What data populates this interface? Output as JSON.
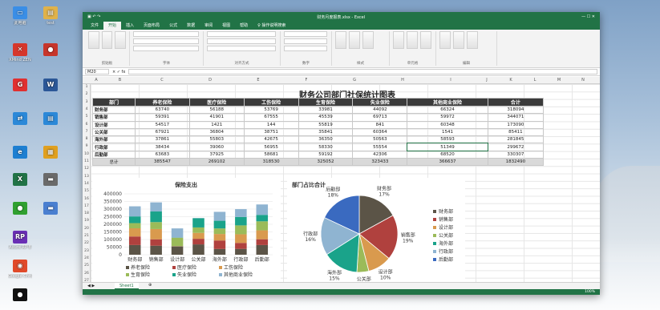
{
  "desktop": {
    "icons": [
      {
        "label": "此电脑",
        "color": "#3a8ee6",
        "glyph": "▭",
        "x": 0,
        "y": 0
      },
      {
        "label": "test",
        "color": "#e0b24a",
        "glyph": "▤",
        "x": 38,
        "y": 0
      },
      {
        "label": "XMind ZEN",
        "color": "#d6372b",
        "glyph": "✕",
        "x": 0,
        "y": 46
      },
      {
        "label": "",
        "color": "#c7352b",
        "glyph": "●",
        "x": 38,
        "y": 46
      },
      {
        "label": "",
        "color": "#e03030",
        "glyph": "G",
        "x": 0,
        "y": 90
      },
      {
        "label": "",
        "color": "#2b5797",
        "glyph": "W",
        "x": 38,
        "y": 90
      },
      {
        "label": "",
        "color": "#2b88d8",
        "glyph": "⇄",
        "x": 0,
        "y": 132
      },
      {
        "label": "",
        "color": "#2b88d8",
        "glyph": "▤",
        "x": 38,
        "y": 132
      },
      {
        "label": "",
        "color": "#1e7fd1",
        "glyph": "e",
        "x": 0,
        "y": 174
      },
      {
        "label": "",
        "color": "#e0a020",
        "glyph": "▦",
        "x": 38,
        "y": 174
      },
      {
        "label": "",
        "color": "#217346",
        "glyph": "X",
        "x": 0,
        "y": 208
      },
      {
        "label": "",
        "color": "#6a6a6a",
        "glyph": "▬",
        "x": 38,
        "y": 208
      },
      {
        "label": "",
        "color": "#30a030",
        "glyph": "●",
        "x": 0,
        "y": 244
      },
      {
        "label": "",
        "color": "#4a7fd0",
        "glyph": "▬",
        "x": 38,
        "y": 244
      },
      {
        "label": "Axure RP 8",
        "color": "#6a2fb5",
        "glyph": "RP",
        "x": 0,
        "y": 280
      },
      {
        "label": "Google Chrome",
        "color": "#e04a2a",
        "glyph": "◉",
        "x": 0,
        "y": 316
      },
      {
        "label": "",
        "color": "#111111",
        "glyph": "●",
        "x": 0,
        "y": 352
      }
    ]
  },
  "excel": {
    "title": "财务月度报表.xlsx - Excel",
    "tabs": [
      "文件",
      "开始",
      "插入",
      "页面布局",
      "公式",
      "数据",
      "审阅",
      "视图",
      "帮助",
      "♀ 操作说明搜索"
    ],
    "active_tab": "开始",
    "ribbon_groups": [
      "剪贴板",
      "字体",
      "对齐方式",
      "数字",
      "样式",
      "单元格",
      "编辑"
    ],
    "namebox": "M20",
    "columns": [
      "A",
      "B",
      "C",
      "D",
      "E",
      "F",
      "G",
      "H",
      "I",
      "J",
      "K",
      "L",
      "M",
      "N",
      "O",
      "P",
      "Q",
      "R",
      "S",
      "T"
    ],
    "sheet_tab": "Sheet1",
    "zoom": "100%"
  },
  "table": {
    "title": "财务公司部门社保统计图表",
    "headers": [
      "部门",
      "养老保险",
      "医疗保险",
      "工伤保险",
      "生育保险",
      "失业保险",
      "其他商业保险",
      "合计"
    ],
    "rows": [
      [
        "财务部",
        "63740",
        "56188",
        "53769",
        "33981",
        "44092",
        "66324",
        "318094"
      ],
      [
        "销售部",
        "59391",
        "41901",
        "67555",
        "45539",
        "69713",
        "59972",
        "344071"
      ],
      [
        "设计部",
        "54517",
        "1421",
        "144",
        "55819",
        "841",
        "60348",
        "173090"
      ],
      [
        "公关部",
        "67921",
        "36804",
        "38751",
        "35841",
        "60364",
        "1541",
        "85411"
      ],
      [
        "海外部",
        "37861",
        "55803",
        "42675",
        "36350",
        "50563",
        "58593",
        "281845"
      ],
      [
        "行政部",
        "38434",
        "39060",
        "56955",
        "58330",
        "55554",
        "51349",
        "299672"
      ],
      [
        "后勤部",
        "63683",
        "37925",
        "58681",
        "59192",
        "42306",
        "68520",
        "330307"
      ]
    ],
    "total": [
      "总计",
      "385547",
      "269102",
      "318530",
      "325052",
      "323433",
      "366637",
      "1832490"
    ]
  },
  "chart_data": [
    {
      "type": "bar",
      "title": "保险支出",
      "categories": [
        "财务部",
        "销售部",
        "设计部",
        "公关部",
        "海外部",
        "行政部",
        "后勤部"
      ],
      "series": [
        {
          "name": "养老保险",
          "values": [
            63740,
            59391,
            54517,
            67921,
            37861,
            38434,
            63683
          ]
        },
        {
          "name": "医疗保险",
          "values": [
            56188,
            41901,
            1421,
            36804,
            55803,
            39060,
            37925
          ]
        },
        {
          "name": "工伤保险",
          "values": [
            53769,
            67555,
            144,
            38751,
            42675,
            56955,
            58681
          ]
        },
        {
          "name": "生育保险",
          "values": [
            33981,
            45539,
            55819,
            35841,
            36350,
            58330,
            59192
          ]
        },
        {
          "name": "失业保险",
          "values": [
            44092,
            69713,
            841,
            60364,
            50563,
            55554,
            42306
          ]
        },
        {
          "name": "其他商业保险",
          "values": [
            66324,
            59972,
            60348,
            1541,
            58593,
            51349,
            68520
          ]
        }
      ],
      "ylim": [
        0,
        400000
      ],
      "yticks": [
        "0",
        "50000",
        "100000",
        "150000",
        "200000",
        "250000",
        "300000",
        "350000",
        "400000"
      ],
      "legend": "bottom"
    },
    {
      "type": "pie",
      "title": "部门占比合计",
      "categories": [
        "财务部",
        "销售部",
        "设计部",
        "公关部",
        "海外部",
        "行政部",
        "后勤部"
      ],
      "labels": [
        "17%",
        "19%",
        "10%",
        "5%",
        "15%",
        "16%",
        "18%"
      ],
      "values": [
        17,
        19,
        10,
        5,
        15,
        16,
        18
      ],
      "legend": "right"
    }
  ],
  "colors": {
    "excel_green": "#217346",
    "series": [
      "#5b5447",
      "#b0413e",
      "#d99a4e",
      "#9bbb59",
      "#1aa38a",
      "#8fb4d1",
      "#3a6ac0"
    ]
  }
}
